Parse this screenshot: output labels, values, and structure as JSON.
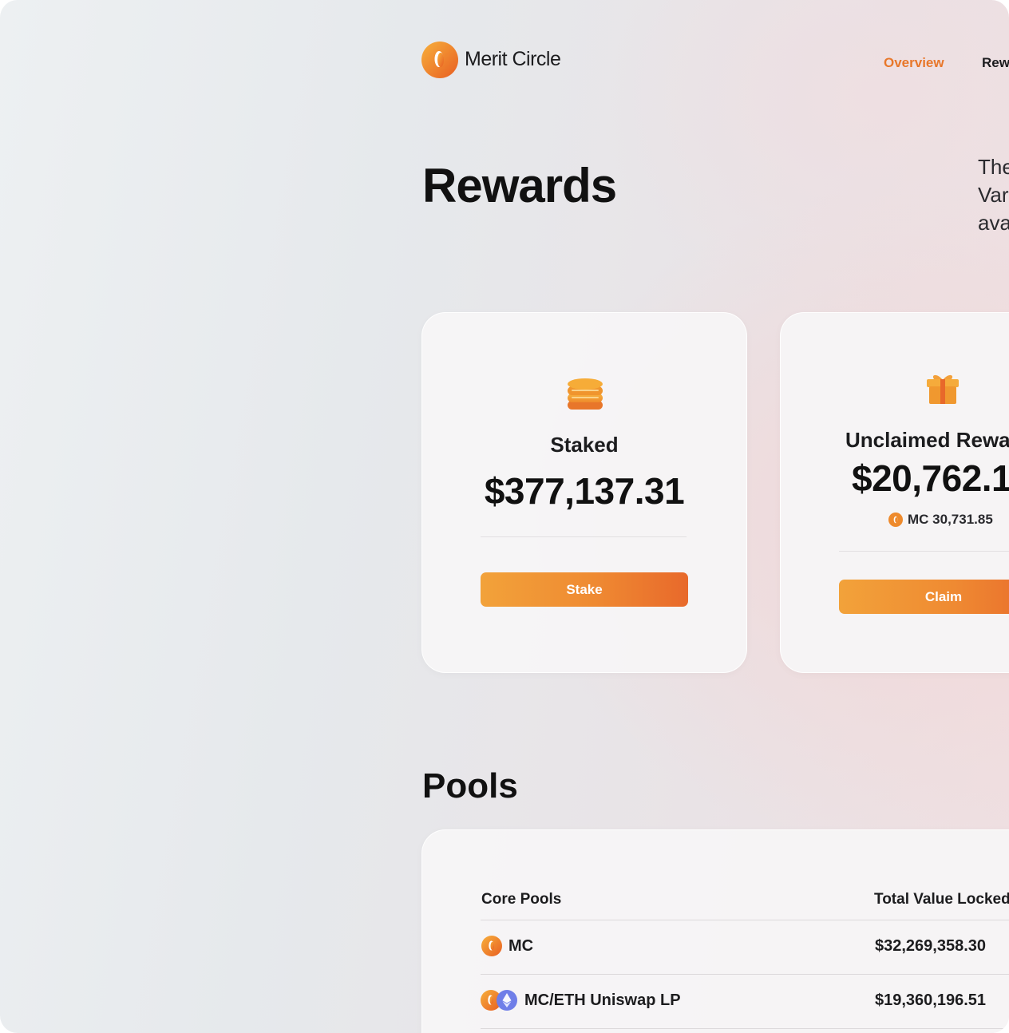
{
  "brand": {
    "name": "Merit Circle",
    "accent": "#e8772a"
  },
  "nav": {
    "items": [
      {
        "label": "Overview",
        "active": true
      },
      {
        "label": "Rew",
        "active": false
      }
    ]
  },
  "page": {
    "title": "Rewards",
    "intro_lines": [
      "The",
      "Var",
      "ava"
    ]
  },
  "cards": {
    "staked": {
      "icon": "coin-stack-icon",
      "label": "Staked",
      "value": "$377,137.31",
      "button": "Stake"
    },
    "unclaimed": {
      "icon": "gift-icon",
      "label": "Unclaimed Rewa",
      "value": "$20,762.1",
      "sub_amount": "MC 30,731.85",
      "button": "Claim"
    }
  },
  "pools": {
    "title": "Pools",
    "columns": [
      "Core Pools",
      "Total Value Locked"
    ],
    "rows": [
      {
        "name": "MC",
        "tvl": "$32,269,358.30",
        "icons": [
          "mc-token-icon"
        ]
      },
      {
        "name": "MC/ETH Uniswap LP",
        "tvl": "$19,360,196.51",
        "icons": [
          "mc-token-icon",
          "eth-token-icon"
        ]
      }
    ]
  }
}
